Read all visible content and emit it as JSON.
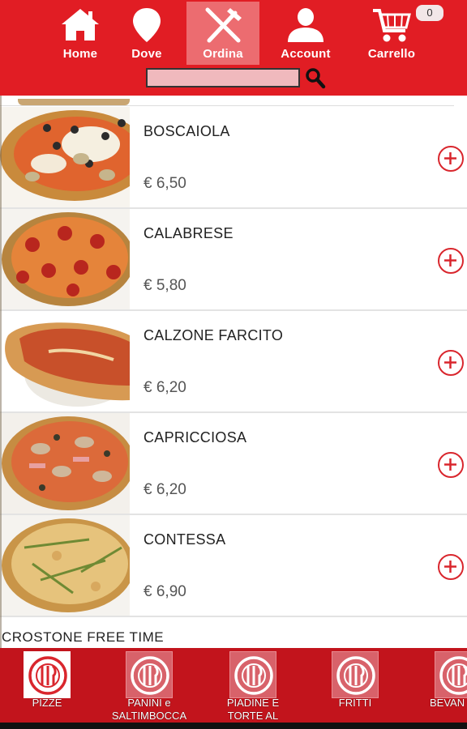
{
  "header": {
    "nav": [
      {
        "label": "Home",
        "icon": "home-icon"
      },
      {
        "label": "Dove",
        "icon": "map-pin-icon"
      },
      {
        "label": "Ordina",
        "icon": "fork-knife-icon",
        "active": true
      },
      {
        "label": "Account",
        "icon": "user-icon"
      },
      {
        "label": "Carrello",
        "icon": "cart-icon"
      }
    ],
    "cart_count": "0",
    "search": {
      "value": "",
      "placeholder": ""
    }
  },
  "products": [
    {
      "name": "BOSCAIOLA",
      "price": "€ 6,50"
    },
    {
      "name": "CALABRESE",
      "price": "€ 5,80"
    },
    {
      "name": "CALZONE FARCITO",
      "price": "€ 6,20"
    },
    {
      "name": "CAPRICCIOSA",
      "price": "€ 6,20"
    },
    {
      "name": "CONTESSA",
      "price": "€ 6,90"
    }
  ],
  "partial_item": "CROSTONE FREE TIME",
  "categories": [
    {
      "label": "PIZZE",
      "active": true
    },
    {
      "label": "PANINI e\nSALTIMBOCCA"
    },
    {
      "label": "PIADINE E\nTORTE AL"
    },
    {
      "label": "FRITTI"
    },
    {
      "label": "BEVAN"
    }
  ],
  "colors": {
    "brand_red": "#e11d24",
    "bar_red": "#c2141c",
    "active_tab": "#ec6c70"
  }
}
